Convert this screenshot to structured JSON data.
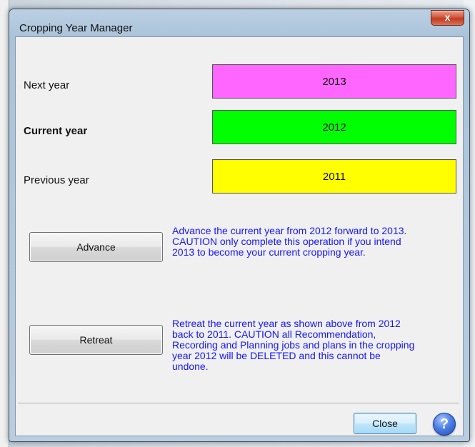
{
  "window": {
    "title": "Cropping Year Manager",
    "close_glyph": "x"
  },
  "years": {
    "next": {
      "label": "Next year",
      "value": "2013",
      "color": "#ff66ff"
    },
    "current": {
      "label": "Current year",
      "value": "2012",
      "color": "#00ff00"
    },
    "previous": {
      "label": "Previous year",
      "value": "2011",
      "color": "#ffff00"
    }
  },
  "advance": {
    "button_label": "Advance",
    "description_lines": [
      "Advance the current year from 2012 forward to 2013.",
      "CAUTION only complete this operation if you intend",
      "2013 to become your current cropping year."
    ]
  },
  "retreat": {
    "button_label": "Retreat",
    "description_lines": [
      "Retreat the current year as shown above from 2012",
      "back to 2011.  CAUTION all Recommendation,",
      "Recording and Planning jobs and plans in the cropping",
      "year 2012 will be DELETED and this cannot be",
      "undone."
    ]
  },
  "footer": {
    "close_label": "Close",
    "help_glyph": "?",
    "help_icon": "help-icon"
  },
  "colors": {
    "description_text": "#1515ff"
  }
}
